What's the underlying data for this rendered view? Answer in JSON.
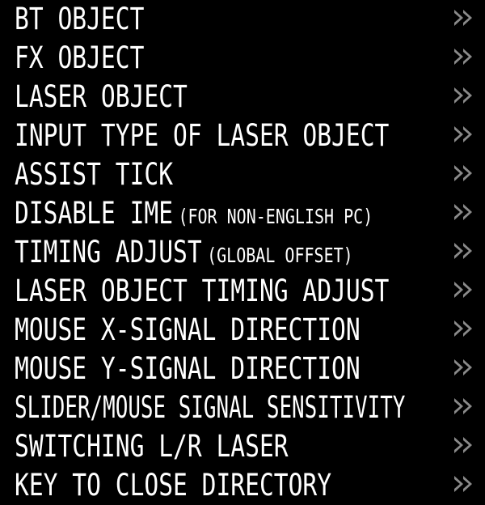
{
  "menu": {
    "items": [
      {
        "label": "BT OBJECT",
        "note": ""
      },
      {
        "label": "FX OBJECT",
        "note": ""
      },
      {
        "label": "LASER OBJECT",
        "note": ""
      },
      {
        "label": "INPUT TYPE OF LASER OBJECT",
        "note": ""
      },
      {
        "label": "ASSIST TICK",
        "note": ""
      },
      {
        "label": "DISABLE IME",
        "note": "(FOR NON-ENGLISH PC)"
      },
      {
        "label": "TIMING ADJUST",
        "note": "(GLOBAL OFFSET)"
      },
      {
        "label": "LASER OBJECT TIMING ADJUST",
        "note": ""
      },
      {
        "label": "MOUSE X-SIGNAL DIRECTION",
        "note": ""
      },
      {
        "label": "MOUSE Y-SIGNAL DIRECTION",
        "note": ""
      },
      {
        "label": "SLIDER/MOUSE SIGNAL SENSITIVITY",
        "note": ""
      },
      {
        "label": "SWITCHING L/R LASER",
        "note": ""
      },
      {
        "label": "KEY TO CLOSE DIRECTORY",
        "note": ""
      }
    ],
    "arrow_icon": "double-chevron-right-icon",
    "colors": {
      "text": "#ffffff",
      "arrow": "#8a8a8a",
      "background": "#000000"
    }
  }
}
